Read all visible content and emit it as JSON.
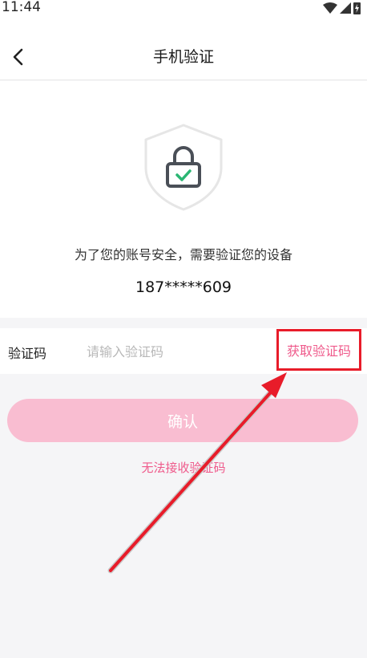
{
  "status_bar": {
    "time": "11:44"
  },
  "header": {
    "title": "手机验证"
  },
  "verification": {
    "description": "为了您的账号安全，需要验证您的设备",
    "phone_number": "187*****609"
  },
  "code_field": {
    "label": "验证码",
    "placeholder": "请输入验证码",
    "get_code_label": "获取验证码"
  },
  "confirm_button": {
    "label": "确认"
  },
  "help_link": {
    "label": "无法接收验证码"
  },
  "colors": {
    "accent": "#ef5a8b",
    "confirm_bg": "#f9bdd1",
    "highlight_border": "#e81c2a",
    "check_green": "#2bb673"
  }
}
